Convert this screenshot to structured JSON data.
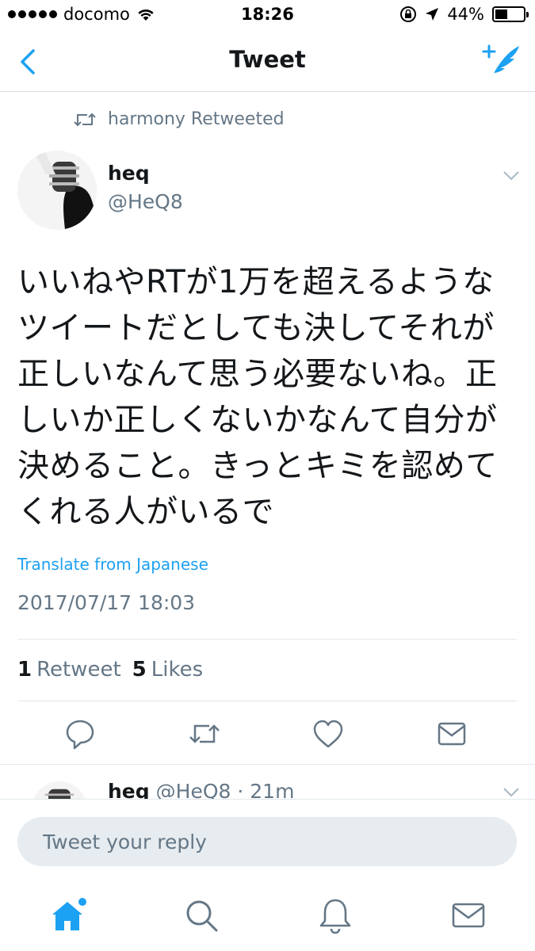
{
  "status_bar": {
    "carrier": "docomo",
    "time": "18:26",
    "battery": "44%",
    "battery_level": 0.44
  },
  "nav": {
    "title": "Tweet"
  },
  "tweet": {
    "retweet_context": "harmony Retweeted",
    "author_name": "heq",
    "author_handle": "@HeQ8",
    "text_lines": [
      "いいねやRTが1万を超えるような",
      "ツイートだとしても決してそれが",
      "正しいなんて思う必要ないね。正",
      "しいか正しくないかなんて自分が",
      "決めること。きっとキミを認めて",
      "くれる人がいるで"
    ],
    "translate_link": "Translate from Japanese",
    "timestamp": "2017/07/17 18:03",
    "retweet_count": "1",
    "retweet_label": "Retweet",
    "like_count": "5",
    "like_label": "Likes"
  },
  "reply_preview": {
    "name": "heq",
    "meta": "@HeQ8 · 21m"
  },
  "reply_bar": {
    "placeholder": "Tweet your reply"
  },
  "colors": {
    "accent": "#1da1f2",
    "secondary_text": "#657786",
    "primary_text": "#14171a"
  }
}
